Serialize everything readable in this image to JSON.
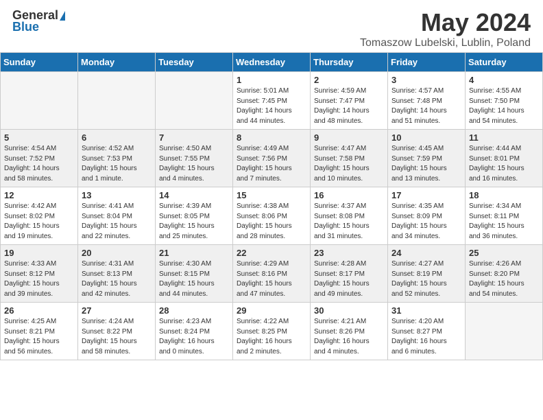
{
  "header": {
    "logo_general": "General",
    "logo_blue": "Blue",
    "month_title": "May 2024",
    "location": "Tomaszow Lubelski, Lublin, Poland"
  },
  "days_of_week": [
    "Sunday",
    "Monday",
    "Tuesday",
    "Wednesday",
    "Thursday",
    "Friday",
    "Saturday"
  ],
  "weeks": [
    [
      {
        "day": "",
        "info": ""
      },
      {
        "day": "",
        "info": ""
      },
      {
        "day": "",
        "info": ""
      },
      {
        "day": "1",
        "info": "Sunrise: 5:01 AM\nSunset: 7:45 PM\nDaylight: 14 hours\nand 44 minutes."
      },
      {
        "day": "2",
        "info": "Sunrise: 4:59 AM\nSunset: 7:47 PM\nDaylight: 14 hours\nand 48 minutes."
      },
      {
        "day": "3",
        "info": "Sunrise: 4:57 AM\nSunset: 7:48 PM\nDaylight: 14 hours\nand 51 minutes."
      },
      {
        "day": "4",
        "info": "Sunrise: 4:55 AM\nSunset: 7:50 PM\nDaylight: 14 hours\nand 54 minutes."
      }
    ],
    [
      {
        "day": "5",
        "info": "Sunrise: 4:54 AM\nSunset: 7:52 PM\nDaylight: 14 hours\nand 58 minutes."
      },
      {
        "day": "6",
        "info": "Sunrise: 4:52 AM\nSunset: 7:53 PM\nDaylight: 15 hours\nand 1 minute."
      },
      {
        "day": "7",
        "info": "Sunrise: 4:50 AM\nSunset: 7:55 PM\nDaylight: 15 hours\nand 4 minutes."
      },
      {
        "day": "8",
        "info": "Sunrise: 4:49 AM\nSunset: 7:56 PM\nDaylight: 15 hours\nand 7 minutes."
      },
      {
        "day": "9",
        "info": "Sunrise: 4:47 AM\nSunset: 7:58 PM\nDaylight: 15 hours\nand 10 minutes."
      },
      {
        "day": "10",
        "info": "Sunrise: 4:45 AM\nSunset: 7:59 PM\nDaylight: 15 hours\nand 13 minutes."
      },
      {
        "day": "11",
        "info": "Sunrise: 4:44 AM\nSunset: 8:01 PM\nDaylight: 15 hours\nand 16 minutes."
      }
    ],
    [
      {
        "day": "12",
        "info": "Sunrise: 4:42 AM\nSunset: 8:02 PM\nDaylight: 15 hours\nand 19 minutes."
      },
      {
        "day": "13",
        "info": "Sunrise: 4:41 AM\nSunset: 8:04 PM\nDaylight: 15 hours\nand 22 minutes."
      },
      {
        "day": "14",
        "info": "Sunrise: 4:39 AM\nSunset: 8:05 PM\nDaylight: 15 hours\nand 25 minutes."
      },
      {
        "day": "15",
        "info": "Sunrise: 4:38 AM\nSunset: 8:06 PM\nDaylight: 15 hours\nand 28 minutes."
      },
      {
        "day": "16",
        "info": "Sunrise: 4:37 AM\nSunset: 8:08 PM\nDaylight: 15 hours\nand 31 minutes."
      },
      {
        "day": "17",
        "info": "Sunrise: 4:35 AM\nSunset: 8:09 PM\nDaylight: 15 hours\nand 34 minutes."
      },
      {
        "day": "18",
        "info": "Sunrise: 4:34 AM\nSunset: 8:11 PM\nDaylight: 15 hours\nand 36 minutes."
      }
    ],
    [
      {
        "day": "19",
        "info": "Sunrise: 4:33 AM\nSunset: 8:12 PM\nDaylight: 15 hours\nand 39 minutes."
      },
      {
        "day": "20",
        "info": "Sunrise: 4:31 AM\nSunset: 8:13 PM\nDaylight: 15 hours\nand 42 minutes."
      },
      {
        "day": "21",
        "info": "Sunrise: 4:30 AM\nSunset: 8:15 PM\nDaylight: 15 hours\nand 44 minutes."
      },
      {
        "day": "22",
        "info": "Sunrise: 4:29 AM\nSunset: 8:16 PM\nDaylight: 15 hours\nand 47 minutes."
      },
      {
        "day": "23",
        "info": "Sunrise: 4:28 AM\nSunset: 8:17 PM\nDaylight: 15 hours\nand 49 minutes."
      },
      {
        "day": "24",
        "info": "Sunrise: 4:27 AM\nSunset: 8:19 PM\nDaylight: 15 hours\nand 52 minutes."
      },
      {
        "day": "25",
        "info": "Sunrise: 4:26 AM\nSunset: 8:20 PM\nDaylight: 15 hours\nand 54 minutes."
      }
    ],
    [
      {
        "day": "26",
        "info": "Sunrise: 4:25 AM\nSunset: 8:21 PM\nDaylight: 15 hours\nand 56 minutes."
      },
      {
        "day": "27",
        "info": "Sunrise: 4:24 AM\nSunset: 8:22 PM\nDaylight: 15 hours\nand 58 minutes."
      },
      {
        "day": "28",
        "info": "Sunrise: 4:23 AM\nSunset: 8:24 PM\nDaylight: 16 hours\nand 0 minutes."
      },
      {
        "day": "29",
        "info": "Sunrise: 4:22 AM\nSunset: 8:25 PM\nDaylight: 16 hours\nand 2 minutes."
      },
      {
        "day": "30",
        "info": "Sunrise: 4:21 AM\nSunset: 8:26 PM\nDaylight: 16 hours\nand 4 minutes."
      },
      {
        "day": "31",
        "info": "Sunrise: 4:20 AM\nSunset: 8:27 PM\nDaylight: 16 hours\nand 6 minutes."
      },
      {
        "day": "",
        "info": ""
      }
    ]
  ]
}
